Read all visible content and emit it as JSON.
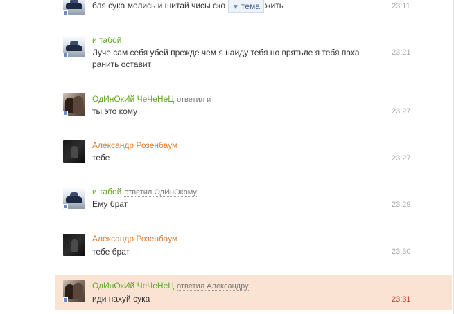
{
  "messages": [
    {
      "author": "",
      "reply_to": "",
      "text": "бля сука молись и шитай чисы ско    осталось жить",
      "time": "23:11",
      "avatar": "car"
    },
    {
      "author": "и табой",
      "reply_to": "",
      "text": "Луче сам себя убей прежде чем я найду тебя но врятьле я тебя паха ранить оставит",
      "time": "23:21",
      "avatar": "car"
    },
    {
      "author": "ОдИнОкИй ЧеЧеНеЦ",
      "reply_to": "ответил и",
      "text": "ты это кому",
      "time": "23:27",
      "avatar": "couple"
    },
    {
      "author": "Александр Розенбаум",
      "reply_to": "",
      "text": "тебе",
      "time": "23:27",
      "avatar": "dark"
    },
    {
      "author": "и табой",
      "reply_to": "ответил ОдИнОкому",
      "text": "Ему брат",
      "time": "23:29",
      "avatar": "car"
    },
    {
      "author": "Александр Розенбаум",
      "reply_to": "",
      "text": "тебе брат",
      "time": "23:30",
      "avatar": "dark"
    },
    {
      "author": "ОдИнОкИй ЧеЧеНеЦ",
      "reply_to": "ответил Александру",
      "text": "иди нахуй сука",
      "time": "23:31",
      "avatar": "couple"
    }
  ],
  "topic_button": {
    "label": "тема",
    "icon": "triangle-down-icon"
  },
  "colors": {
    "author_green": "#5fa62a",
    "author_orange": "#e07b2c",
    "highlight_bg": "#fbe3d3",
    "time_gray": "#a8a8a8",
    "time_highlight": "#c43a2e"
  }
}
